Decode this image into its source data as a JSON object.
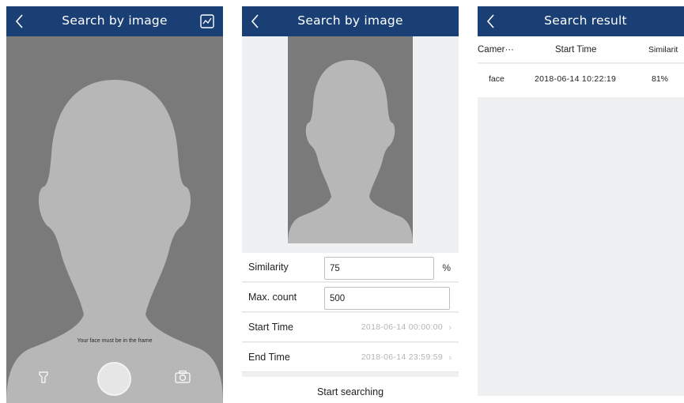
{
  "camera_screen": {
    "title": "Search by image",
    "hint": "Your face must be in the frame",
    "icons": [
      "back-icon",
      "gallery-icon",
      "flashlight-icon",
      "shutter-button",
      "switch-camera-icon"
    ]
  },
  "search_screen": {
    "title": "Search by image",
    "fields": {
      "similarity": {
        "label": "Similarity",
        "value": "75",
        "unit": "%"
      },
      "max_count": {
        "label": "Max. count",
        "value": "500"
      },
      "start_time": {
        "label": "Start Time",
        "value": "2018-06-14 00:00:00"
      },
      "end_time": {
        "label": "End Time",
        "value": "2018-06-14 23:59:59"
      }
    },
    "start_button": "Start searching"
  },
  "result_screen": {
    "title": "Search result",
    "columns": [
      "Camer···",
      "Start Time",
      "Similarit"
    ],
    "rows": [
      [
        "face",
        "2018-06-14 10:22:19",
        "81%"
      ]
    ]
  },
  "colors": {
    "navbar": "#1a3f75",
    "camera_background": "#7a7a7a",
    "silhouette": "#b7b7b7",
    "page_background": "#eef0f2"
  }
}
